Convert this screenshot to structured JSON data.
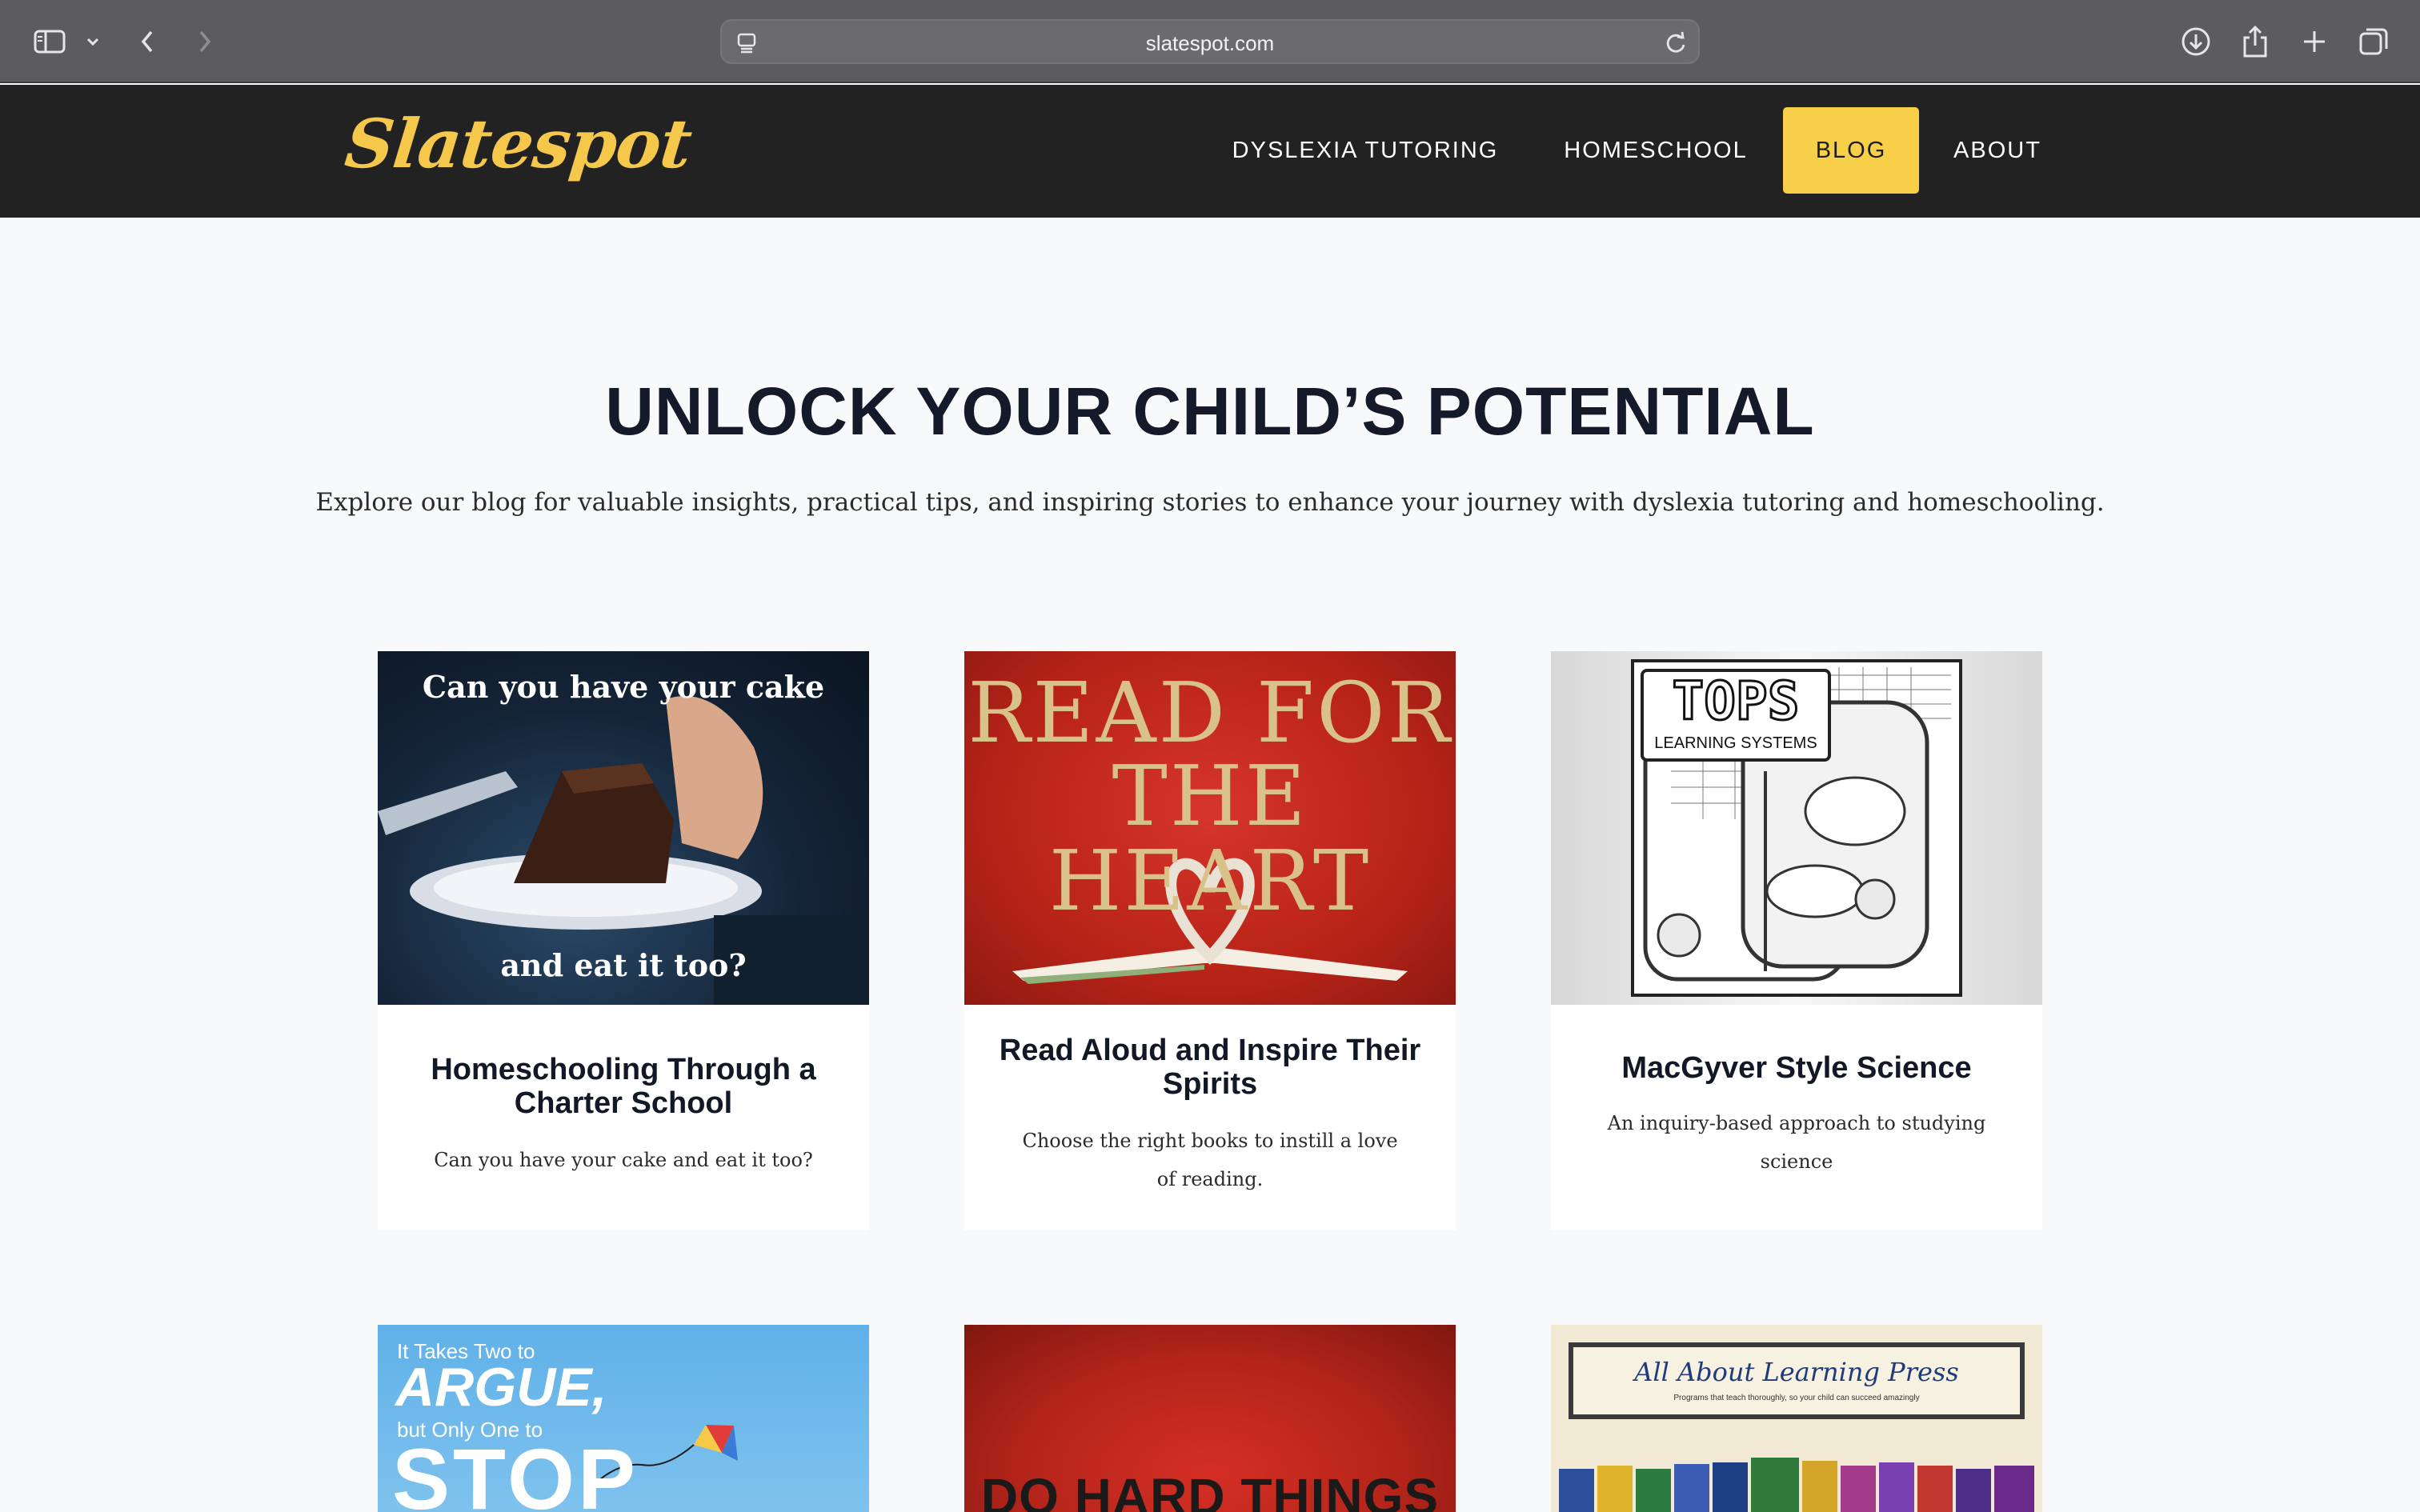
{
  "browser": {
    "url": "slatespot.com"
  },
  "site": {
    "logo": "Slatespot",
    "nav": [
      {
        "label": "DYSLEXIA TUTORING",
        "active": false
      },
      {
        "label": "HOMESCHOOL",
        "active": false
      },
      {
        "label": "BLOG",
        "active": true
      },
      {
        "label": "ABOUT",
        "active": false
      }
    ]
  },
  "hero": {
    "title": "UNLOCK YOUR CHILD’S POTENTIAL",
    "subtitle": "Explore our blog for valuable insights, practical tips, and inspiring stories to enhance your journey with dyslexia tutoring and homeschooling."
  },
  "posts": [
    {
      "title": "Homeschooling Through a Charter School",
      "description": "Can you have your cake and eat it too?",
      "image_text_top": "Can you have your cake",
      "image_text_bottom": "and eat it too?"
    },
    {
      "title": "Read Aloud and Inspire Their Spirits",
      "description": "Choose the right books to instill a love of reading.",
      "image_text_top": "READ FOR",
      "image_text_bottom": "THE HEART"
    },
    {
      "title": "MacGyver Style Science",
      "description": "An inquiry-based approach to studying science",
      "image_text_top": "TOPS",
      "image_text_bottom": "LEARNING SYSTEMS"
    },
    {
      "image_text_top": "It Takes Two to",
      "image_text_mid": "ARGUE,",
      "image_text_small": "but Only One to",
      "image_text_bottom": "STOP"
    },
    {
      "image_text_top": "DO HARD THINGS"
    },
    {
      "image_text_top": "All About Learning Press",
      "image_text_small": "Programs that teach thoroughly, so your child can succeed amazingly"
    }
  ],
  "colors": {
    "accent": "#f8cf48",
    "header_bg": "#222222",
    "page_bg": "#f8f9fb",
    "title": "#141a2a"
  }
}
